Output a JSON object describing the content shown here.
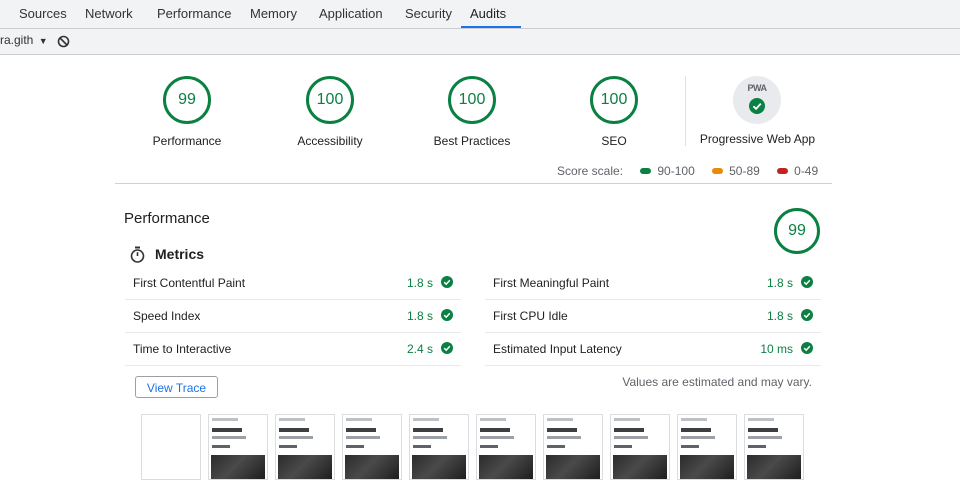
{
  "devtools": {
    "tabs": [
      {
        "label": "Sources"
      },
      {
        "label": "Network"
      },
      {
        "label": "Performance"
      },
      {
        "label": "Memory"
      },
      {
        "label": "Application"
      },
      {
        "label": "Security"
      },
      {
        "label": "Audits",
        "active": true
      }
    ],
    "toolbar": {
      "url_text": "ra.gith"
    }
  },
  "scores": [
    {
      "value": "99",
      "label": "Performance"
    },
    {
      "value": "100",
      "label": "Accessibility"
    },
    {
      "value": "100",
      "label": "Best Practices"
    },
    {
      "value": "100",
      "label": "SEO"
    }
  ],
  "pwa": {
    "badge_text": "PWA",
    "label": "Progressive Web App"
  },
  "score_scale": {
    "label": "Score scale:",
    "items": [
      {
        "range": "90-100",
        "color": "#0b8043"
      },
      {
        "range": "50-89",
        "color": "#e8890c"
      },
      {
        "range": "0-49",
        "color": "#c5221f"
      }
    ]
  },
  "performance": {
    "title": "Performance",
    "score": "99",
    "metrics_title": "Metrics",
    "metrics": [
      {
        "name": "First Contentful Paint",
        "value": "1.8 s"
      },
      {
        "name": "First Meaningful Paint",
        "value": "1.8 s"
      },
      {
        "name": "Speed Index",
        "value": "1.8 s"
      },
      {
        "name": "First CPU Idle",
        "value": "1.8 s"
      },
      {
        "name": "Time to Interactive",
        "value": "2.4 s"
      },
      {
        "name": "Estimated Input Latency",
        "value": "10 ms"
      }
    ],
    "view_trace_label": "View Trace",
    "note": "Values are estimated and may vary."
  },
  "colors": {
    "pass": "#0b8043",
    "accent": "#1a73e8"
  }
}
